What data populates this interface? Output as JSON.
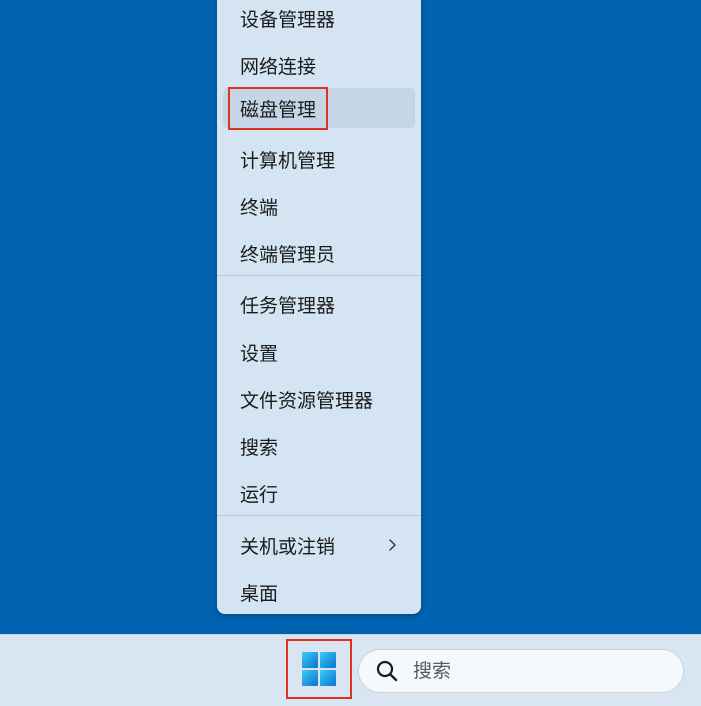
{
  "menu": {
    "items": [
      {
        "label": "设备管理器"
      },
      {
        "label": "网络连接"
      },
      {
        "label": "磁盘管理"
      },
      {
        "label": "计算机管理"
      },
      {
        "label": "终端"
      },
      {
        "label": "终端管理员"
      },
      {
        "label": "任务管理器"
      },
      {
        "label": "设置"
      },
      {
        "label": "文件资源管理器"
      },
      {
        "label": "搜索"
      },
      {
        "label": "运行"
      },
      {
        "label": "关机或注销"
      },
      {
        "label": "桌面"
      }
    ]
  },
  "taskbar": {
    "search_placeholder": "搜索"
  },
  "colors": {
    "desktop": "#0063b1",
    "menu_background": "#d4e4f2",
    "highlight_border": "#e0311e",
    "taskbar": "#d9e6f1"
  },
  "icons": {
    "start": "windows-logo-icon",
    "search": "search-icon",
    "submenu": "chevron-right-icon"
  }
}
